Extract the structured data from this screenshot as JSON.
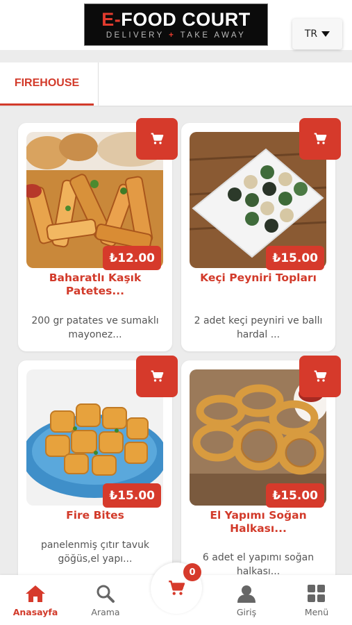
{
  "header": {
    "logo_main_dash": "E-",
    "logo_main_rest": "FOOD COURT",
    "logo_sub_left": "DELIVERY",
    "logo_sub_plus": "+",
    "logo_sub_right": "TAKE AWAY",
    "language": "TR"
  },
  "categories": [
    {
      "label": "FIREHOUSE",
      "active": true
    }
  ],
  "products": [
    {
      "name": "Baharatlı Kaşık Patetes...",
      "price": "₺12.00",
      "description": "200 gr patates ve sumaklı mayonez...",
      "photo": "potato-wedges"
    },
    {
      "name": "Keçi Peyniri Topları",
      "price": "₺15.00",
      "description": "2 adet keçi peyniri ve ballı hardal ...",
      "photo": "goat-cheese-balls"
    },
    {
      "name": "Fire Bites",
      "price": "₺15.00",
      "description": "panelenmiş çıtır tavuk göğüs,el yapı...",
      "photo": "chicken-bites"
    },
    {
      "name": "El Yapımı Soğan Halkası...",
      "price": "₺15.00",
      "description": "6 adet el yapımı soğan halkası...",
      "photo": "onion-rings"
    }
  ],
  "bottom_nav": [
    {
      "label": "Anasayfa",
      "icon": "home-icon",
      "active": true
    },
    {
      "label": "Arama",
      "icon": "search-icon",
      "active": false
    },
    {
      "label": "Giriş",
      "icon": "user-icon",
      "active": false
    },
    {
      "label": "Menü",
      "icon": "grid-icon",
      "active": false
    }
  ],
  "cart": {
    "count": "0",
    "icon": "cart-icon"
  },
  "colors": {
    "accent": "#d63a2b",
    "background": "#ececec"
  }
}
